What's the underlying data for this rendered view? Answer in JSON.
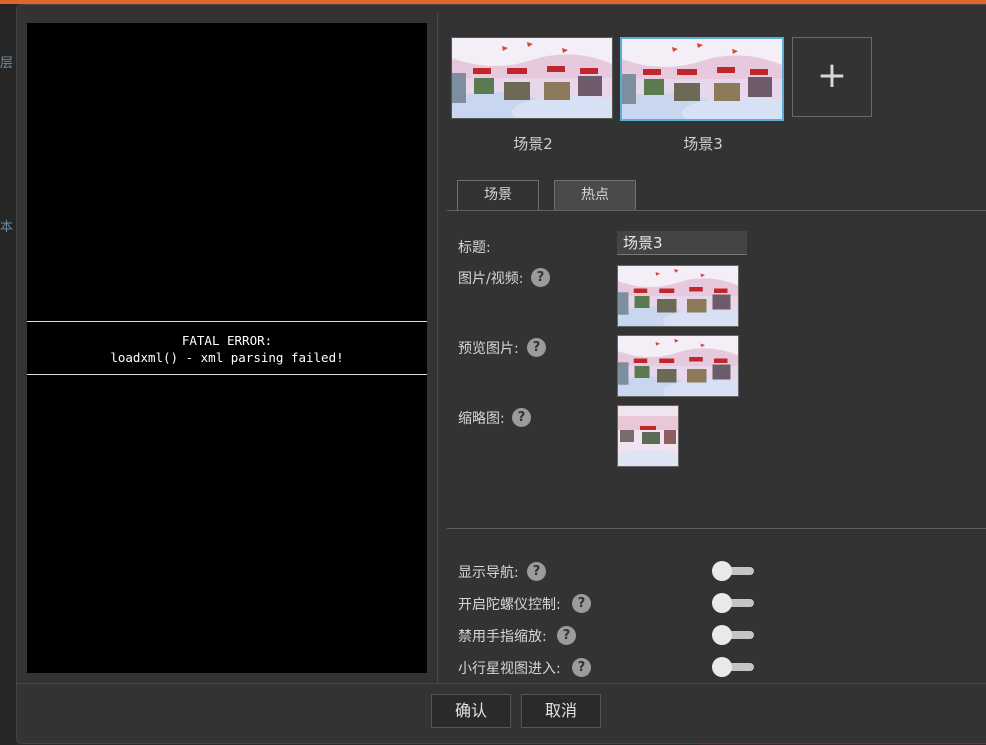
{
  "viewer": {
    "error_line1": "FATAL ERROR:",
    "error_line2": "loadxml() - xml parsing failed!"
  },
  "background_fragments": [
    "层",
    "本"
  ],
  "scenes": [
    {
      "label": "场景2",
      "selected": false
    },
    {
      "label": "场景3",
      "selected": true
    }
  ],
  "add_scene_symbol": "+",
  "tabs": [
    {
      "label": "场景",
      "active": false
    },
    {
      "label": "热点",
      "active": true
    }
  ],
  "form": {
    "title_label": "标题:",
    "title_value": "场景3",
    "media_label": "图片/视频:",
    "preview_label": "预览图片:",
    "thumbnail_label": "缩略图:",
    "help_symbol": "?"
  },
  "toggles": [
    {
      "label": "显示导航:",
      "on": false
    },
    {
      "label": "开启陀螺仪控制:",
      "on": false
    },
    {
      "label": "禁用手指缩放:",
      "on": false
    },
    {
      "label": "小行星视图进入:",
      "on": false
    }
  ],
  "footer": {
    "confirm": "确认",
    "cancel": "取消"
  },
  "colors": {
    "accent_top": "#e0662a",
    "selected_border": "#5aaed6"
  }
}
